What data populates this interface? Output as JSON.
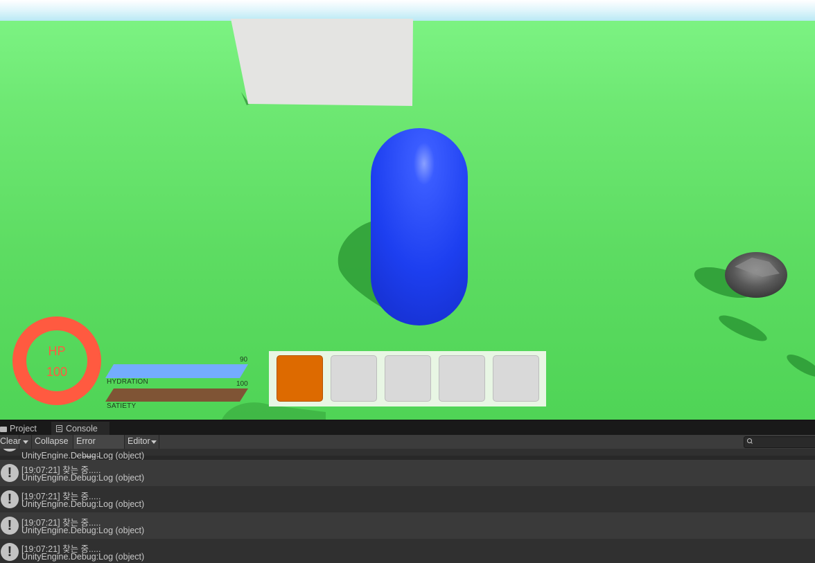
{
  "hud": {
    "hp_label": "HP",
    "hp_value": "100",
    "hydration_label": "HYDRATION",
    "hydration_value": "90",
    "satiety_label": "SATIETY",
    "satiety_value": "100",
    "hp_color": "#ff5a40",
    "hydration_color": "#74acff",
    "satiety_color": "#7f5435"
  },
  "inventory": {
    "slot_count": 5,
    "active_slot": 1,
    "active_color": "#dd6a00"
  },
  "editor": {
    "tabs": [
      {
        "label": "Project",
        "icon": "folder-icon"
      },
      {
        "label": "Console",
        "icon": "console-icon"
      }
    ],
    "toolbar": {
      "clear": "Clear",
      "collapse": "Collapse",
      "error_pause": "Error Pause",
      "editor": "Editor"
    },
    "logs": [
      {
        "time_msg": "",
        "source": "UnityEngine.Debug:Log (object)"
      },
      {
        "time_msg": "[19:07:21] 찾는 중.....",
        "source": "UnityEngine.Debug:Log (object)"
      },
      {
        "time_msg": "[19:07:21] 찾는 중.....",
        "source": "UnityEngine.Debug:Log (object)"
      },
      {
        "time_msg": "[19:07:21] 찾는 중.....",
        "source": "UnityEngine.Debug:Log (object)"
      },
      {
        "time_msg": "[19:07:21] 찾는 중.....",
        "source": "UnityEngine.Debug:Log (object)"
      }
    ]
  }
}
